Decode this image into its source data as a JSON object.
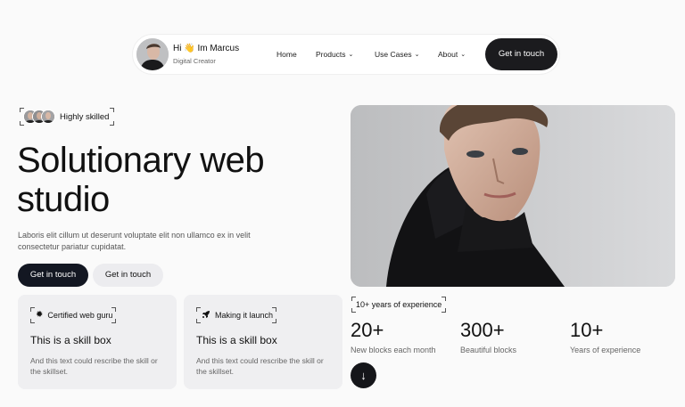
{
  "nav": {
    "greeting": "Hi 👋 Im Marcus",
    "role": "Digital Creator",
    "items": [
      {
        "label": "Home",
        "dropdown": false
      },
      {
        "label": "Products",
        "dropdown": true
      },
      {
        "label": "Use Cases",
        "dropdown": true
      },
      {
        "label": "About",
        "dropdown": true
      }
    ],
    "cta": "Get in touch"
  },
  "hero": {
    "tag": "Highly skilled",
    "headline": "Solutionary web studio",
    "description": "Laboris elit cillum ut deserunt voluptate elit non ullamco ex in velit consectetur pariatur cupidatat.",
    "primary_button": "Get in touch",
    "secondary_button": "Get in touch"
  },
  "skills": [
    {
      "tag": "Certified web guru",
      "icon": "gear-icon",
      "title": "This is a skill box",
      "description": "And this text could rescribe the skill or the skillset."
    },
    {
      "tag": "Making it launch",
      "icon": "rocket-icon",
      "title": "This is a skill box",
      "description": "And this text could rescribe the skill or the skillset."
    }
  ],
  "experience_tag": "10+ years of experience",
  "stats": [
    {
      "value": "20+",
      "label": "New blocks each month"
    },
    {
      "value": "300+",
      "label": "Beautiful blocks"
    },
    {
      "value": "10+",
      "label": "Years of experience"
    }
  ],
  "icons": {
    "arrow": "arrow-down-icon",
    "chevron": "chevron-down-icon"
  },
  "colors": {
    "dark": "#15161a",
    "light_button": "#ececef",
    "card_bg": "#efeff1",
    "page_bg": "#fafafa"
  }
}
